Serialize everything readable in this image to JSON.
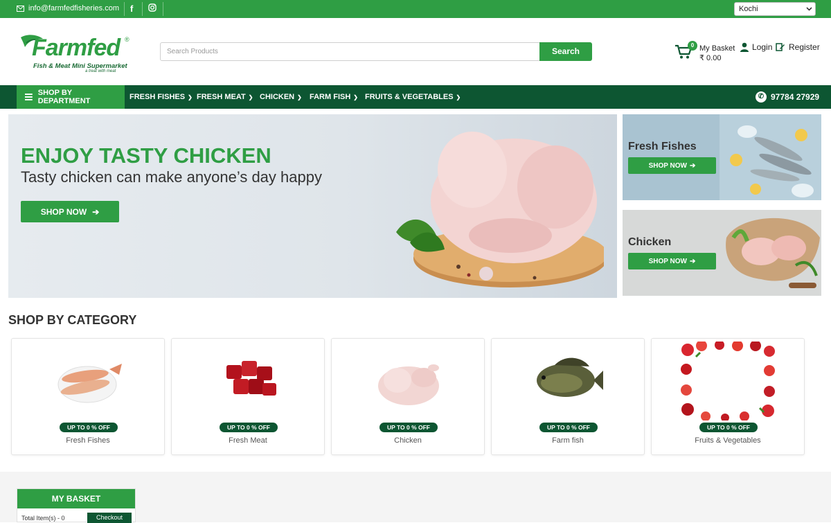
{
  "topbar": {
    "email": "info@farmfedfisheries.com",
    "location_select": "Kochi",
    "social": [
      "facebook-icon",
      "instagram-icon"
    ]
  },
  "brand": {
    "name": "Farmfed",
    "reg_mark": "®",
    "subtitle": "Fish & Meat Mini Supermarket",
    "tagline": "a treat with meat",
    "green": "#2f9e44",
    "dark_green": "#0d5632"
  },
  "search": {
    "placeholder": "Search Products",
    "button_label": "Search"
  },
  "header": {
    "basket_count": "0",
    "basket_label": "My Basket",
    "basket_total": "₹  0.00",
    "login_label": "Login",
    "register_label": "Register"
  },
  "nav": {
    "department_label": "SHOP BY DEPARTMENT",
    "items": [
      "FRESH FISHES",
      "FRESH MEAT",
      "CHICKEN",
      "FARM FISH",
      "FRUITS & VEGETABLES"
    ],
    "phone": "97784 27929"
  },
  "hero": {
    "title": "ENJOY TASTY CHICKEN",
    "subtitle": "Tasty chicken can make anyone’s day happy",
    "button_label": "SHOP NOW"
  },
  "side_banners": [
    {
      "title": "Fresh Fishes",
      "button_label": "SHOP NOW"
    },
    {
      "title": "Chicken",
      "button_label": "SHOP NOW"
    }
  ],
  "categories": {
    "title": "SHOP BY CATEGORY",
    "items": [
      {
        "name": "Fresh Fishes",
        "badge": "UP TO 0 % OFF"
      },
      {
        "name": "Fresh Meat",
        "badge": "UP TO 0 % OFF"
      },
      {
        "name": "Chicken",
        "badge": "UP TO 0 % OFF"
      },
      {
        "name": "Farm fish",
        "badge": "UP TO 0 % OFF"
      },
      {
        "name": "Fruits & Vegetables",
        "badge": "UP TO 0 % OFF"
      }
    ]
  },
  "my_basket": {
    "title": "MY BASKET",
    "items_label": "Total Item(s) - 0",
    "checkout_label": "Checkout"
  }
}
